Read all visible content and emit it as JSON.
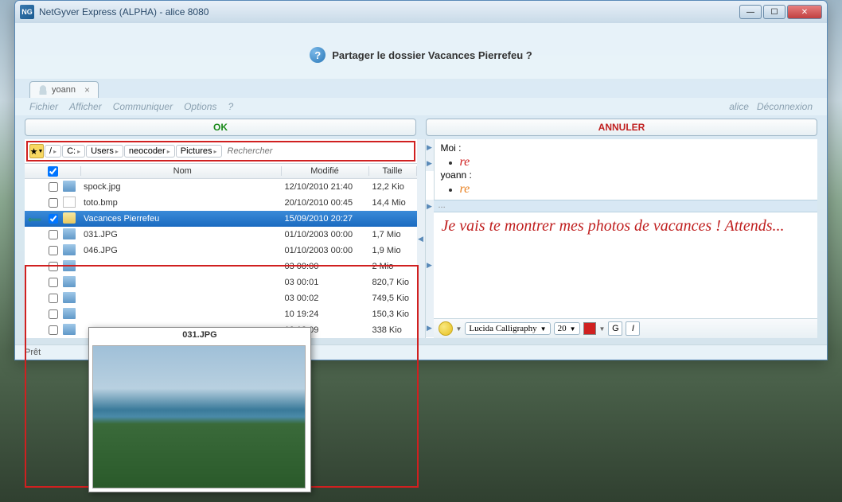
{
  "window": {
    "title": "NetGyver Express (ALPHA) - alice 8080",
    "app_icon_text": "NG"
  },
  "prompt": {
    "text": "Partager le dossier Vacances Pierrefeu ?"
  },
  "tab": {
    "label": "yoann"
  },
  "menu": {
    "file": "Fichier",
    "display": "Afficher",
    "communicate": "Communiquer",
    "options": "Options",
    "help": "?",
    "user": "alice",
    "logout": "Déconnexion"
  },
  "buttons": {
    "ok": "OK",
    "cancel": "ANNULER"
  },
  "breadcrumb": {
    "root": "/",
    "drive": "C:",
    "users": "Users",
    "user": "neocoder",
    "folder": "Pictures",
    "search_placeholder": "Rechercher"
  },
  "columns": {
    "name": "Nom",
    "modified": "Modifié",
    "size": "Taille"
  },
  "files": [
    {
      "checked": false,
      "type": "img",
      "name": "spock.jpg",
      "modified": "12/10/2010 21:40",
      "size": "12,2 Kio",
      "indent": 0
    },
    {
      "checked": false,
      "type": "bmp",
      "name": "toto.bmp",
      "modified": "20/10/2010 00:45",
      "size": "14,4 Mio",
      "indent": 0
    },
    {
      "checked": true,
      "type": "folder",
      "name": "Vacances Pierrefeu",
      "modified": "15/09/2010 20:27",
      "size": "",
      "selected": true,
      "indent": 0
    },
    {
      "checked": false,
      "type": "img",
      "name": "031.JPG",
      "modified": "01/10/2003 00:00",
      "size": "1,7 Mio",
      "indent": 1
    },
    {
      "checked": false,
      "type": "img",
      "name": "046.JPG",
      "modified": "01/10/2003 00:00",
      "size": "1,9 Mio",
      "indent": 1
    },
    {
      "checked": false,
      "type": "img",
      "name": "",
      "modified": "03 00:00",
      "size": "2 Mio",
      "indent": 1
    },
    {
      "checked": false,
      "type": "img",
      "name": "",
      "modified": "03 00:01",
      "size": "820,7 Kio",
      "indent": 1
    },
    {
      "checked": false,
      "type": "img",
      "name": "",
      "modified": "03 00:02",
      "size": "749,5 Kio",
      "indent": 1
    },
    {
      "checked": false,
      "type": "img",
      "name": "",
      "modified": "10 19:24",
      "size": "150,3 Kio",
      "indent": 1
    },
    {
      "checked": false,
      "type": "img",
      "name": "",
      "modified": "10 12:09",
      "size": "338 Kio",
      "indent": 1
    }
  ],
  "preview": {
    "title": "031.JPG"
  },
  "chat": {
    "me_label": "Moi :",
    "other_label": "yoann :",
    "me_msg": "re",
    "other_msg": "re",
    "sep": "...",
    "input_text": "Je vais te montrer mes photos de vacances ! Attends..."
  },
  "format": {
    "font": "Lucida Calligraphy",
    "size": "20",
    "bold": "G",
    "italic": "I",
    "color": "#d02020"
  },
  "status": "Prêt"
}
